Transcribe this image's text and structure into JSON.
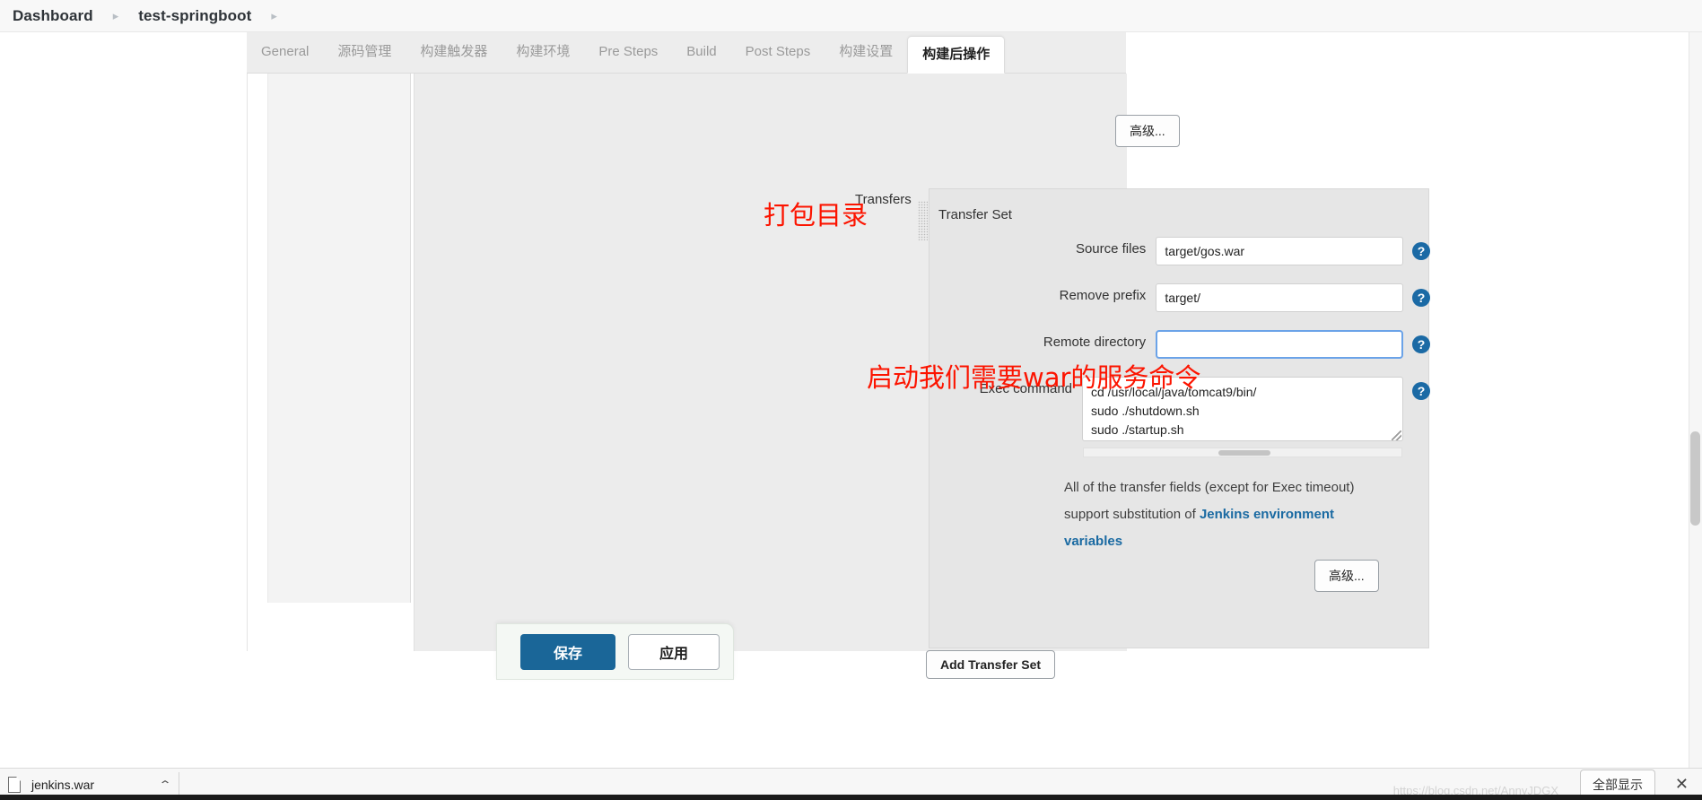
{
  "breadcrumb": {
    "items": [
      {
        "label": "Dashboard"
      },
      {
        "label": "test-springboot"
      }
    ],
    "separator": "▸"
  },
  "tabs": [
    {
      "label": "General",
      "active": false
    },
    {
      "label": "源码管理",
      "active": false
    },
    {
      "label": "构建触发器",
      "active": false
    },
    {
      "label": "构建环境",
      "active": false
    },
    {
      "label": "Pre Steps",
      "active": false
    },
    {
      "label": "Build",
      "active": false
    },
    {
      "label": "Post Steps",
      "active": false
    },
    {
      "label": "构建设置",
      "active": false
    },
    {
      "label": "构建后操作",
      "active": true
    }
  ],
  "form": {
    "advanced_top_label": "高级...",
    "advanced_inner_label": "高级...",
    "transfers_label": "Transfers",
    "transfer_set_title": "Transfer Set",
    "fields": [
      {
        "label": "Source files",
        "value": "target/gos.war",
        "placeholder": "",
        "focused": false,
        "help": "?"
      },
      {
        "label": "Remove prefix",
        "value": "target/",
        "placeholder": "",
        "focused": false,
        "help": "?"
      },
      {
        "label": "Remote directory",
        "value": "",
        "placeholder": "",
        "focused": true,
        "help": "?"
      }
    ],
    "exec": {
      "label": "Exec command",
      "value": "cd /usr/local/java/tomcat9/bin/\nsudo ./shutdown.sh\nsudo ./startup.sh",
      "help": "?"
    },
    "notice": {
      "text_before": "All of the transfer fields (except for Exec timeout) support substitution of ",
      "link_text": "Jenkins environment variables",
      "text_after": ""
    },
    "add_transfer_set_label": "Add Transfer Set"
  },
  "actions": {
    "save_label": "保存",
    "apply_label": "应用"
  },
  "annotations": [
    {
      "text": "打包目录",
      "color": "#fc1400"
    },
    {
      "text": "启动我们需要war的服务命令",
      "color": "#fc1400"
    }
  ],
  "download_shelf": {
    "file_name": "jenkins.war",
    "caret": "⌃",
    "show_all_label": "全部显示",
    "close": "✕",
    "watermark": "https://blog.csdn.net/AnnyJDGX"
  }
}
